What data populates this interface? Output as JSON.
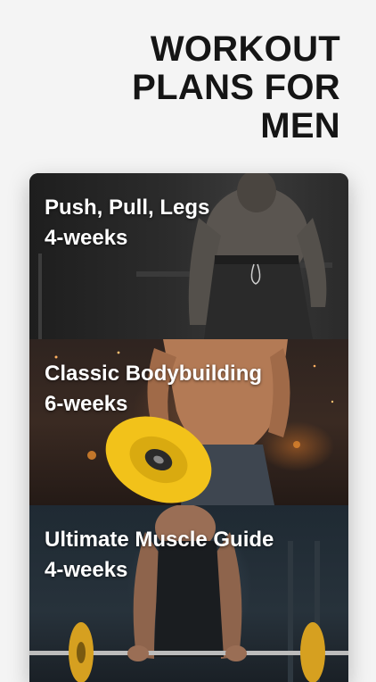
{
  "header": {
    "headline_lines": [
      "WORKOUT",
      "PLANS FOR",
      "MEN"
    ]
  },
  "plans": [
    {
      "title": "Push, Pull, Legs",
      "duration": "4-weeks"
    },
    {
      "title": "Classic Bodybuilding",
      "duration": "6-weeks"
    },
    {
      "title": "Ultimate Muscle Guide",
      "duration": "4-weeks"
    }
  ],
  "colors": {
    "page_background": "#f4f4f4",
    "headline_text": "#151515",
    "card_text": "#ffffff",
    "plate_yellow": "#f2c21a"
  }
}
